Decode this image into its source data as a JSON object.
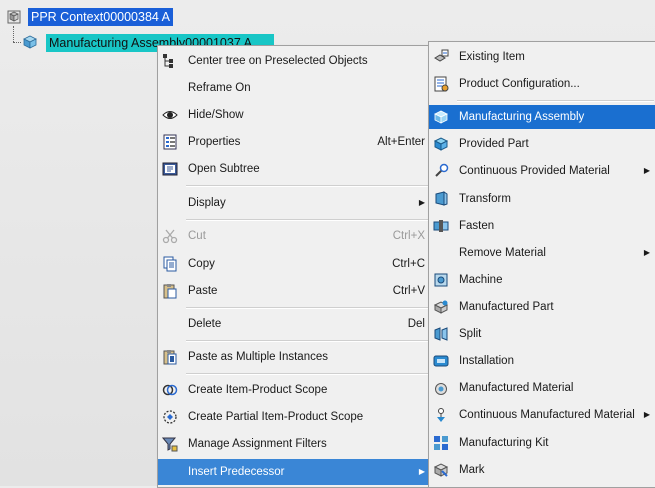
{
  "tree": {
    "root_label": "PPR Context00000384 A",
    "child_label": "Manufacturing Assembly00001037 A"
  },
  "context_menu": {
    "items": [
      {
        "label": "Center tree on Preselected Objects",
        "icon": "center-tree-icon"
      },
      {
        "label": "Reframe On",
        "icon": ""
      },
      {
        "label": "Hide/Show",
        "icon": "eye-icon"
      },
      {
        "label": "Properties",
        "shortcut": "Alt+Enter",
        "icon": "properties-icon"
      },
      {
        "label": "Open Subtree",
        "icon": "open-subtree-icon"
      },
      {
        "label": "Display",
        "icon": "",
        "submenu": true
      },
      {
        "label": "Cut",
        "shortcut": "Ctrl+X",
        "icon": "scissors-icon",
        "disabled": true
      },
      {
        "label": "Copy",
        "shortcut": "Ctrl+C",
        "icon": "copy-icon"
      },
      {
        "label": "Paste",
        "shortcut": "Ctrl+V",
        "icon": "paste-icon"
      },
      {
        "label": "Delete",
        "shortcut": "Del",
        "icon": ""
      },
      {
        "label": "Paste as Multiple Instances",
        "icon": "paste-multiple-icon"
      },
      {
        "label": "Create Item-Product Scope",
        "icon": "scope-icon"
      },
      {
        "label": "Create Partial Item-Product Scope",
        "icon": "partial-scope-icon"
      },
      {
        "label": "Manage Assignment Filters",
        "icon": "filter-icon"
      },
      {
        "label": "Insert Predecessor",
        "icon": "",
        "submenu": true,
        "highlighted": true
      }
    ]
  },
  "submenu": {
    "items": [
      {
        "label": "Existing Item",
        "icon": "existing-item-icon"
      },
      {
        "label": "Product Configuration...",
        "icon": "product-config-icon"
      },
      {
        "label": "Manufacturing Assembly",
        "icon": "manufacturing-assembly-icon",
        "highlighted": true
      },
      {
        "label": "Provided Part",
        "icon": "provided-part-icon"
      },
      {
        "label": "Continuous Provided Material",
        "icon": "continuous-provided-icon",
        "submenu": true
      },
      {
        "label": "Transform",
        "icon": "transform-icon"
      },
      {
        "label": "Fasten",
        "icon": "fasten-icon"
      },
      {
        "label": "Remove Material",
        "icon": "",
        "submenu": true
      },
      {
        "label": "Machine",
        "icon": "machine-icon"
      },
      {
        "label": "Manufactured Part",
        "icon": "manufactured-part-icon"
      },
      {
        "label": "Split",
        "icon": "split-icon"
      },
      {
        "label": "Installation",
        "icon": "installation-icon"
      },
      {
        "label": "Manufactured Material",
        "icon": "manufactured-material-icon"
      },
      {
        "label": "Continuous Manufactured Material",
        "icon": "continuous-manufactured-icon",
        "submenu": true
      },
      {
        "label": "Manufacturing Kit",
        "icon": "manufacturing-kit-icon"
      },
      {
        "label": "Mark",
        "icon": "mark-icon"
      }
    ]
  },
  "colors": {
    "tree_root_highlight": "#1a5fd8",
    "tree_child_highlight": "#18c6c6",
    "menu_highlight": "#3a86d6",
    "submenu_highlight": "#1a6fd0"
  }
}
